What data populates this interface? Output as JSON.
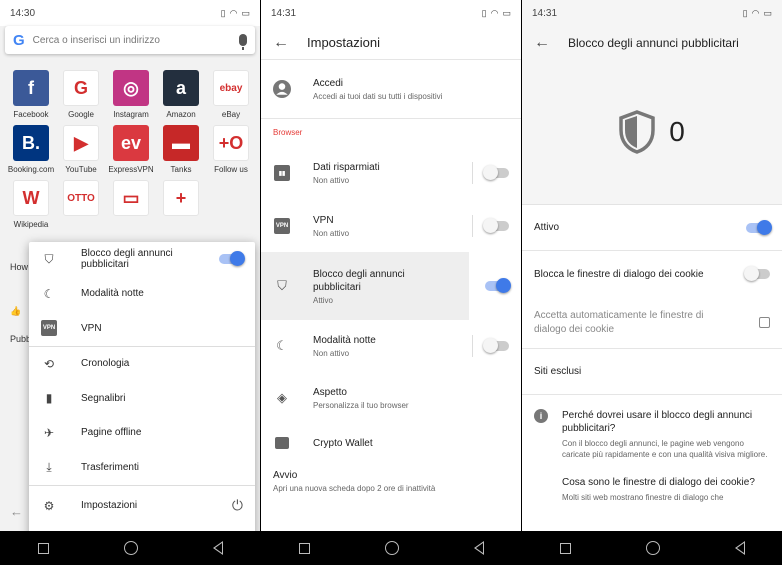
{
  "screen1": {
    "status_time": "14:30",
    "search_placeholder": "Cerca o inserisci un indirizzo",
    "speed_dial": [
      {
        "label": "Facebook",
        "glyph": "f",
        "color": "#3b5998",
        "icon": "facebook-icon"
      },
      {
        "label": "Google",
        "glyph": "G",
        "color": "#ffffff",
        "icon": "google-icon"
      },
      {
        "label": "Instagram",
        "glyph": "◎",
        "color": "#c13584",
        "icon": "instagram-icon"
      },
      {
        "label": "Amazon",
        "glyph": "a",
        "color": "#232f3e",
        "icon": "amazon-icon"
      },
      {
        "label": "eBay",
        "glyph": "ebay",
        "color": "#ffffff",
        "icon": "ebay-icon"
      },
      {
        "label": "Booking.com",
        "glyph": "B.",
        "color": "#003580",
        "icon": "booking-icon"
      },
      {
        "label": "YouTube",
        "glyph": "▶",
        "color": "#ffffff",
        "icon": "youtube-icon"
      },
      {
        "label": "ExpressVPN",
        "glyph": "ev",
        "color": "#da3940",
        "icon": "expressvpn-icon"
      },
      {
        "label": "Tanks",
        "glyph": "▬",
        "color": "#c62828",
        "icon": "tanks-icon"
      },
      {
        "label": "Follow us",
        "glyph": "+O",
        "color": "#ffffff",
        "icon": "follow-us-icon"
      },
      {
        "label": "Wikipedia",
        "glyph": "W",
        "color": "#ffffff",
        "icon": "wikipedia-icon"
      },
      {
        "label": "",
        "glyph": "OTTO",
        "color": "#ffffff",
        "icon": "otto-icon"
      },
      {
        "label": "",
        "glyph": "▭",
        "color": "#ffffff",
        "icon": "desktop-star-icon"
      },
      {
        "label": "",
        "glyph": "+",
        "color": "#ffffff",
        "icon": "add-icon"
      }
    ],
    "peek_how": "How",
    "peek_pubbl": "Pubbl",
    "menu": {
      "ad_block": "Blocco degli annunci pubblicitari",
      "night_mode": "Modalità notte",
      "vpn": "VPN",
      "history": "Cronologia",
      "bookmarks": "Segnalibri",
      "offline_pages": "Pagine offline",
      "downloads": "Trasferimenti",
      "settings": "Impostazioni"
    }
  },
  "screen2": {
    "status_time": "14:31",
    "title": "Impostazioni",
    "signin_title": "Accedi",
    "signin_sub": "Accedi ai tuoi dati su tutti i dispositivi",
    "section_browser": "Browser",
    "data_saving": "Dati risparmiati",
    "data_saving_status": "Non attivo",
    "vpn": "VPN",
    "vpn_status": "Non attivo",
    "ad_block": "Blocco degli annunci pubblicitari",
    "ad_block_status": "Attivo",
    "night_mode": "Modalità notte",
    "night_mode_status": "Non attivo",
    "appearance": "Aspetto",
    "appearance_sub": "Personalizza il tuo browser",
    "crypto_wallet": "Crypto Wallet",
    "startup": "Avvio",
    "startup_sub": "Apri una nuova scheda dopo 2 ore di inattività"
  },
  "screen3": {
    "status_time": "14:31",
    "title": "Blocco degli annunci pubblicitari",
    "blocked_count": "0",
    "active": "Attivo",
    "block_cookie_dialogs": "Blocca le finestre di dialogo dei cookie",
    "auto_accept_cookie": "Accetta automaticamente le finestre di dialogo dei cookie",
    "excluded_sites": "Siti esclusi",
    "faq1_q": "Perché dovrei usare il blocco degli annunci pubblicitari?",
    "faq1_a": "Con il blocco degli annunci, le pagine web vengono caricate più rapidamente e con una qualità visiva migliore.",
    "faq2_q": "Cosa sono le finestre di dialogo dei cookie?",
    "faq2_a": "Molti siti web mostrano finestre di dialogo che"
  }
}
